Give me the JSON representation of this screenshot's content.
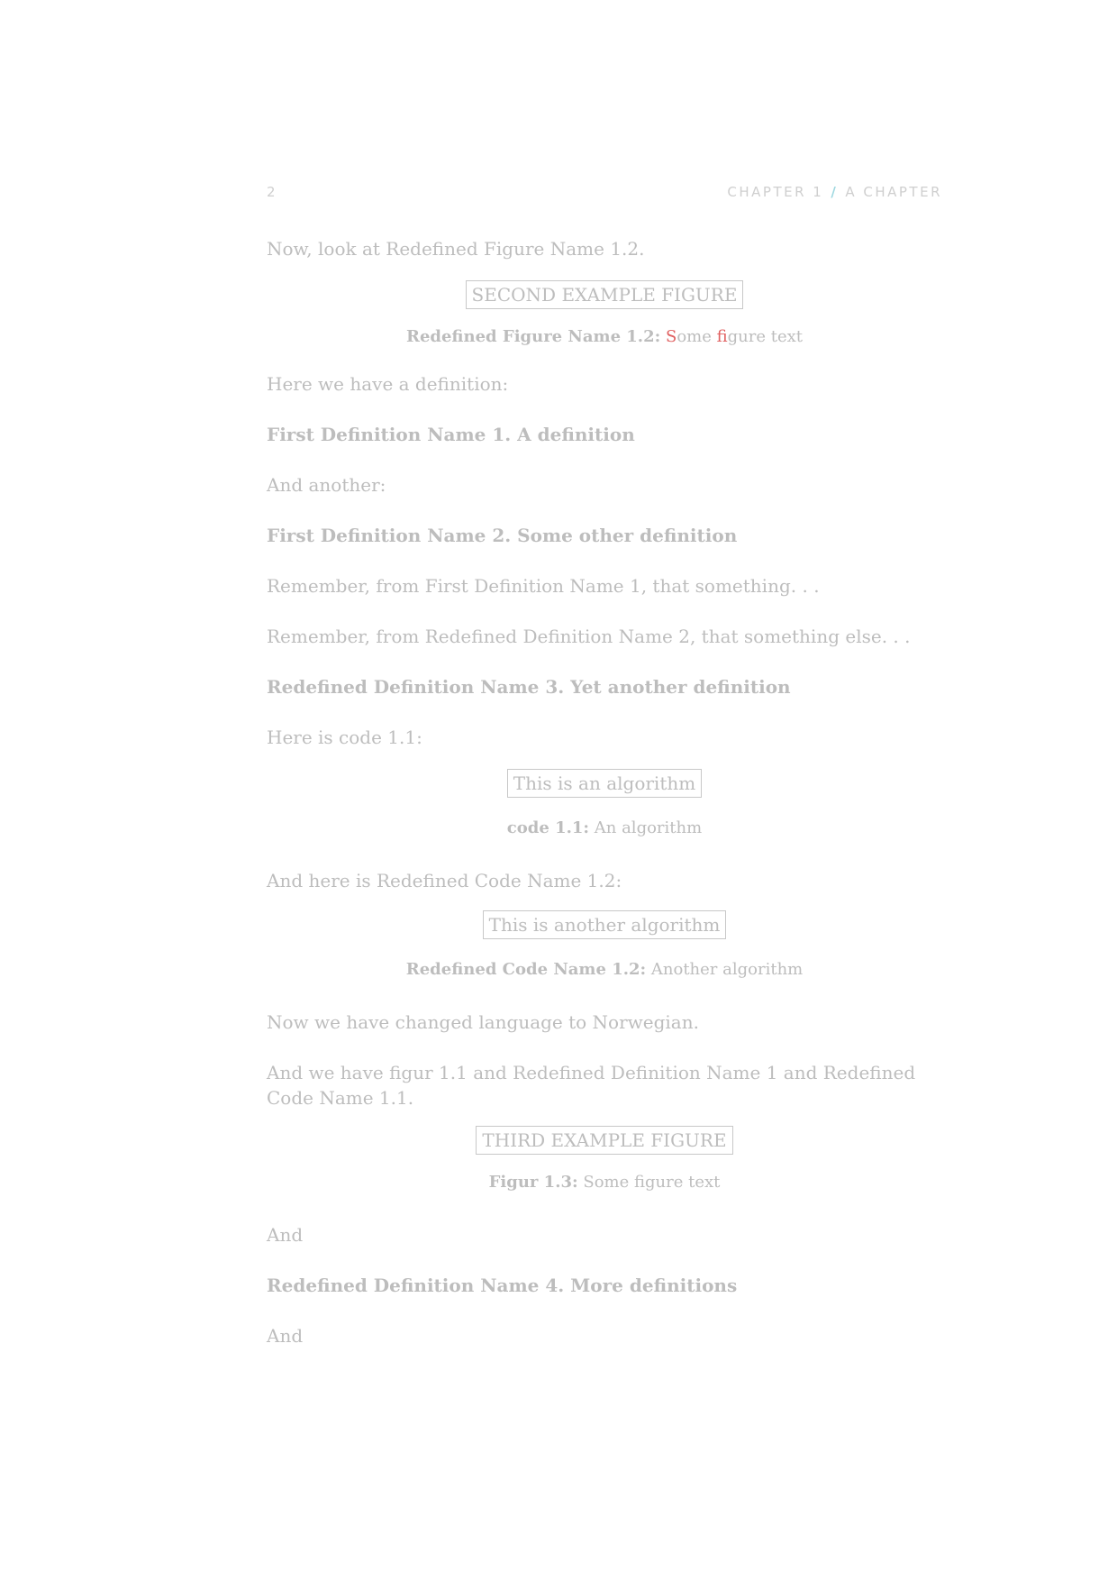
{
  "header": {
    "page_number": "2",
    "chapter": "CHAPTER 1",
    "separator": "/",
    "chapter_title": "A CHAPTER"
  },
  "paragraphs": {
    "p1": "Now, look at Redefined Figure Name 1.2.",
    "p2": "Here we have a definition:",
    "p3": "And another:",
    "p4": "Remember, from First Definition Name 1, that something. . .",
    "p5": "Remember, from Redefined Definition Name 2, that something else. . .",
    "p6": "Here is code 1.1:",
    "p7": "And here is Redefined Code Name 1.2:",
    "p8": "Now we have changed language to Norwegian.",
    "p9": "And we have figur 1.1 and Redefined Definition Name 1 and Redefined Code Name 1.1.",
    "p10": "And",
    "p11": "And"
  },
  "definitions": {
    "d1": "First Definition Name 1. A definition",
    "d2": "First Definition Name 2. Some other definition",
    "d3": "Redefined Definition Name 3. Yet another definition",
    "d4": "Redefined Definition Name 4. More definitions"
  },
  "figures": {
    "f1": {
      "box": "SECOND EXAMPLE FIGURE",
      "label": "Redefined Figure Name 1.2:",
      "cap_s": "S",
      "cap_ome": "ome ",
      "cap_fi": "fi",
      "cap_rest": "gure text"
    },
    "c1": {
      "box": "This is an algorithm",
      "label": "code 1.1:",
      "text": "An algorithm"
    },
    "c2": {
      "box": "This is another algorithm",
      "label": "Redefined Code Name 1.2:",
      "text": "Another algorithm"
    },
    "f3": {
      "box": "THIRD EXAMPLE FIGURE",
      "label": "Figur 1.3:",
      "text": "Some figure text"
    }
  },
  "colors": {
    "text": "#bdbdbd",
    "accent_slash": "#9fd8e0",
    "highlight": "#e06060"
  }
}
